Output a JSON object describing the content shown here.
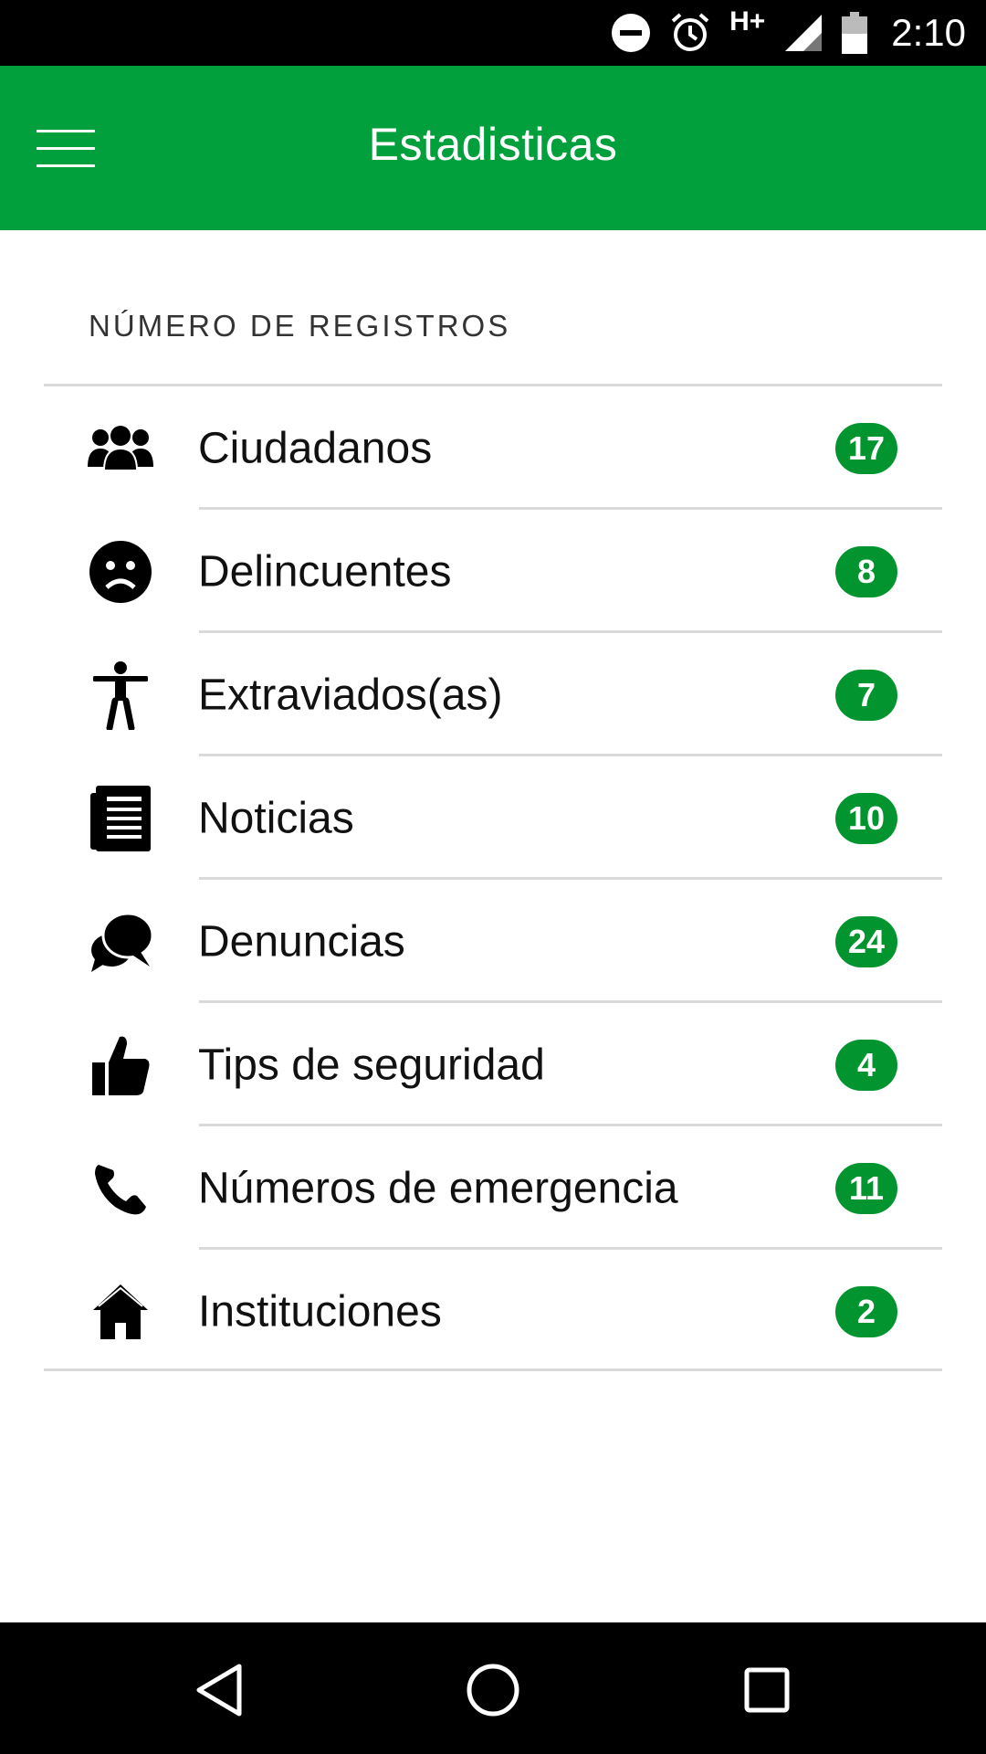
{
  "status_bar": {
    "network": "H+",
    "time": "2:10"
  },
  "app_bar": {
    "title": "Estadisticas",
    "menu_icon": "hamburger-menu-icon"
  },
  "section": {
    "header": "NÚMERO DE REGISTROS"
  },
  "items": [
    {
      "label": "Ciudadanos",
      "count": "17",
      "icon": "people-group-icon"
    },
    {
      "label": "Delincuentes",
      "count": "8",
      "icon": "sad-face-icon"
    },
    {
      "label": "Extraviados(as)",
      "count": "7",
      "icon": "person-accessibility-icon"
    },
    {
      "label": "Noticias",
      "count": "10",
      "icon": "newspaper-icon"
    },
    {
      "label": "Denuncias",
      "count": "24",
      "icon": "chat-bubbles-icon"
    },
    {
      "label": "Tips de seguridad",
      "count": "4",
      "icon": "thumbs-up-icon"
    },
    {
      "label": "Números de emergencia",
      "count": "11",
      "icon": "phone-icon"
    },
    {
      "label": "Instituciones",
      "count": "2",
      "icon": "home-icon"
    }
  ],
  "colors": {
    "app_bar": "#02a03d",
    "badge": "#02942f"
  },
  "nav_bar": {
    "back_icon": "back-triangle-icon",
    "home_icon": "home-circle-icon",
    "recents_icon": "recents-square-icon"
  }
}
